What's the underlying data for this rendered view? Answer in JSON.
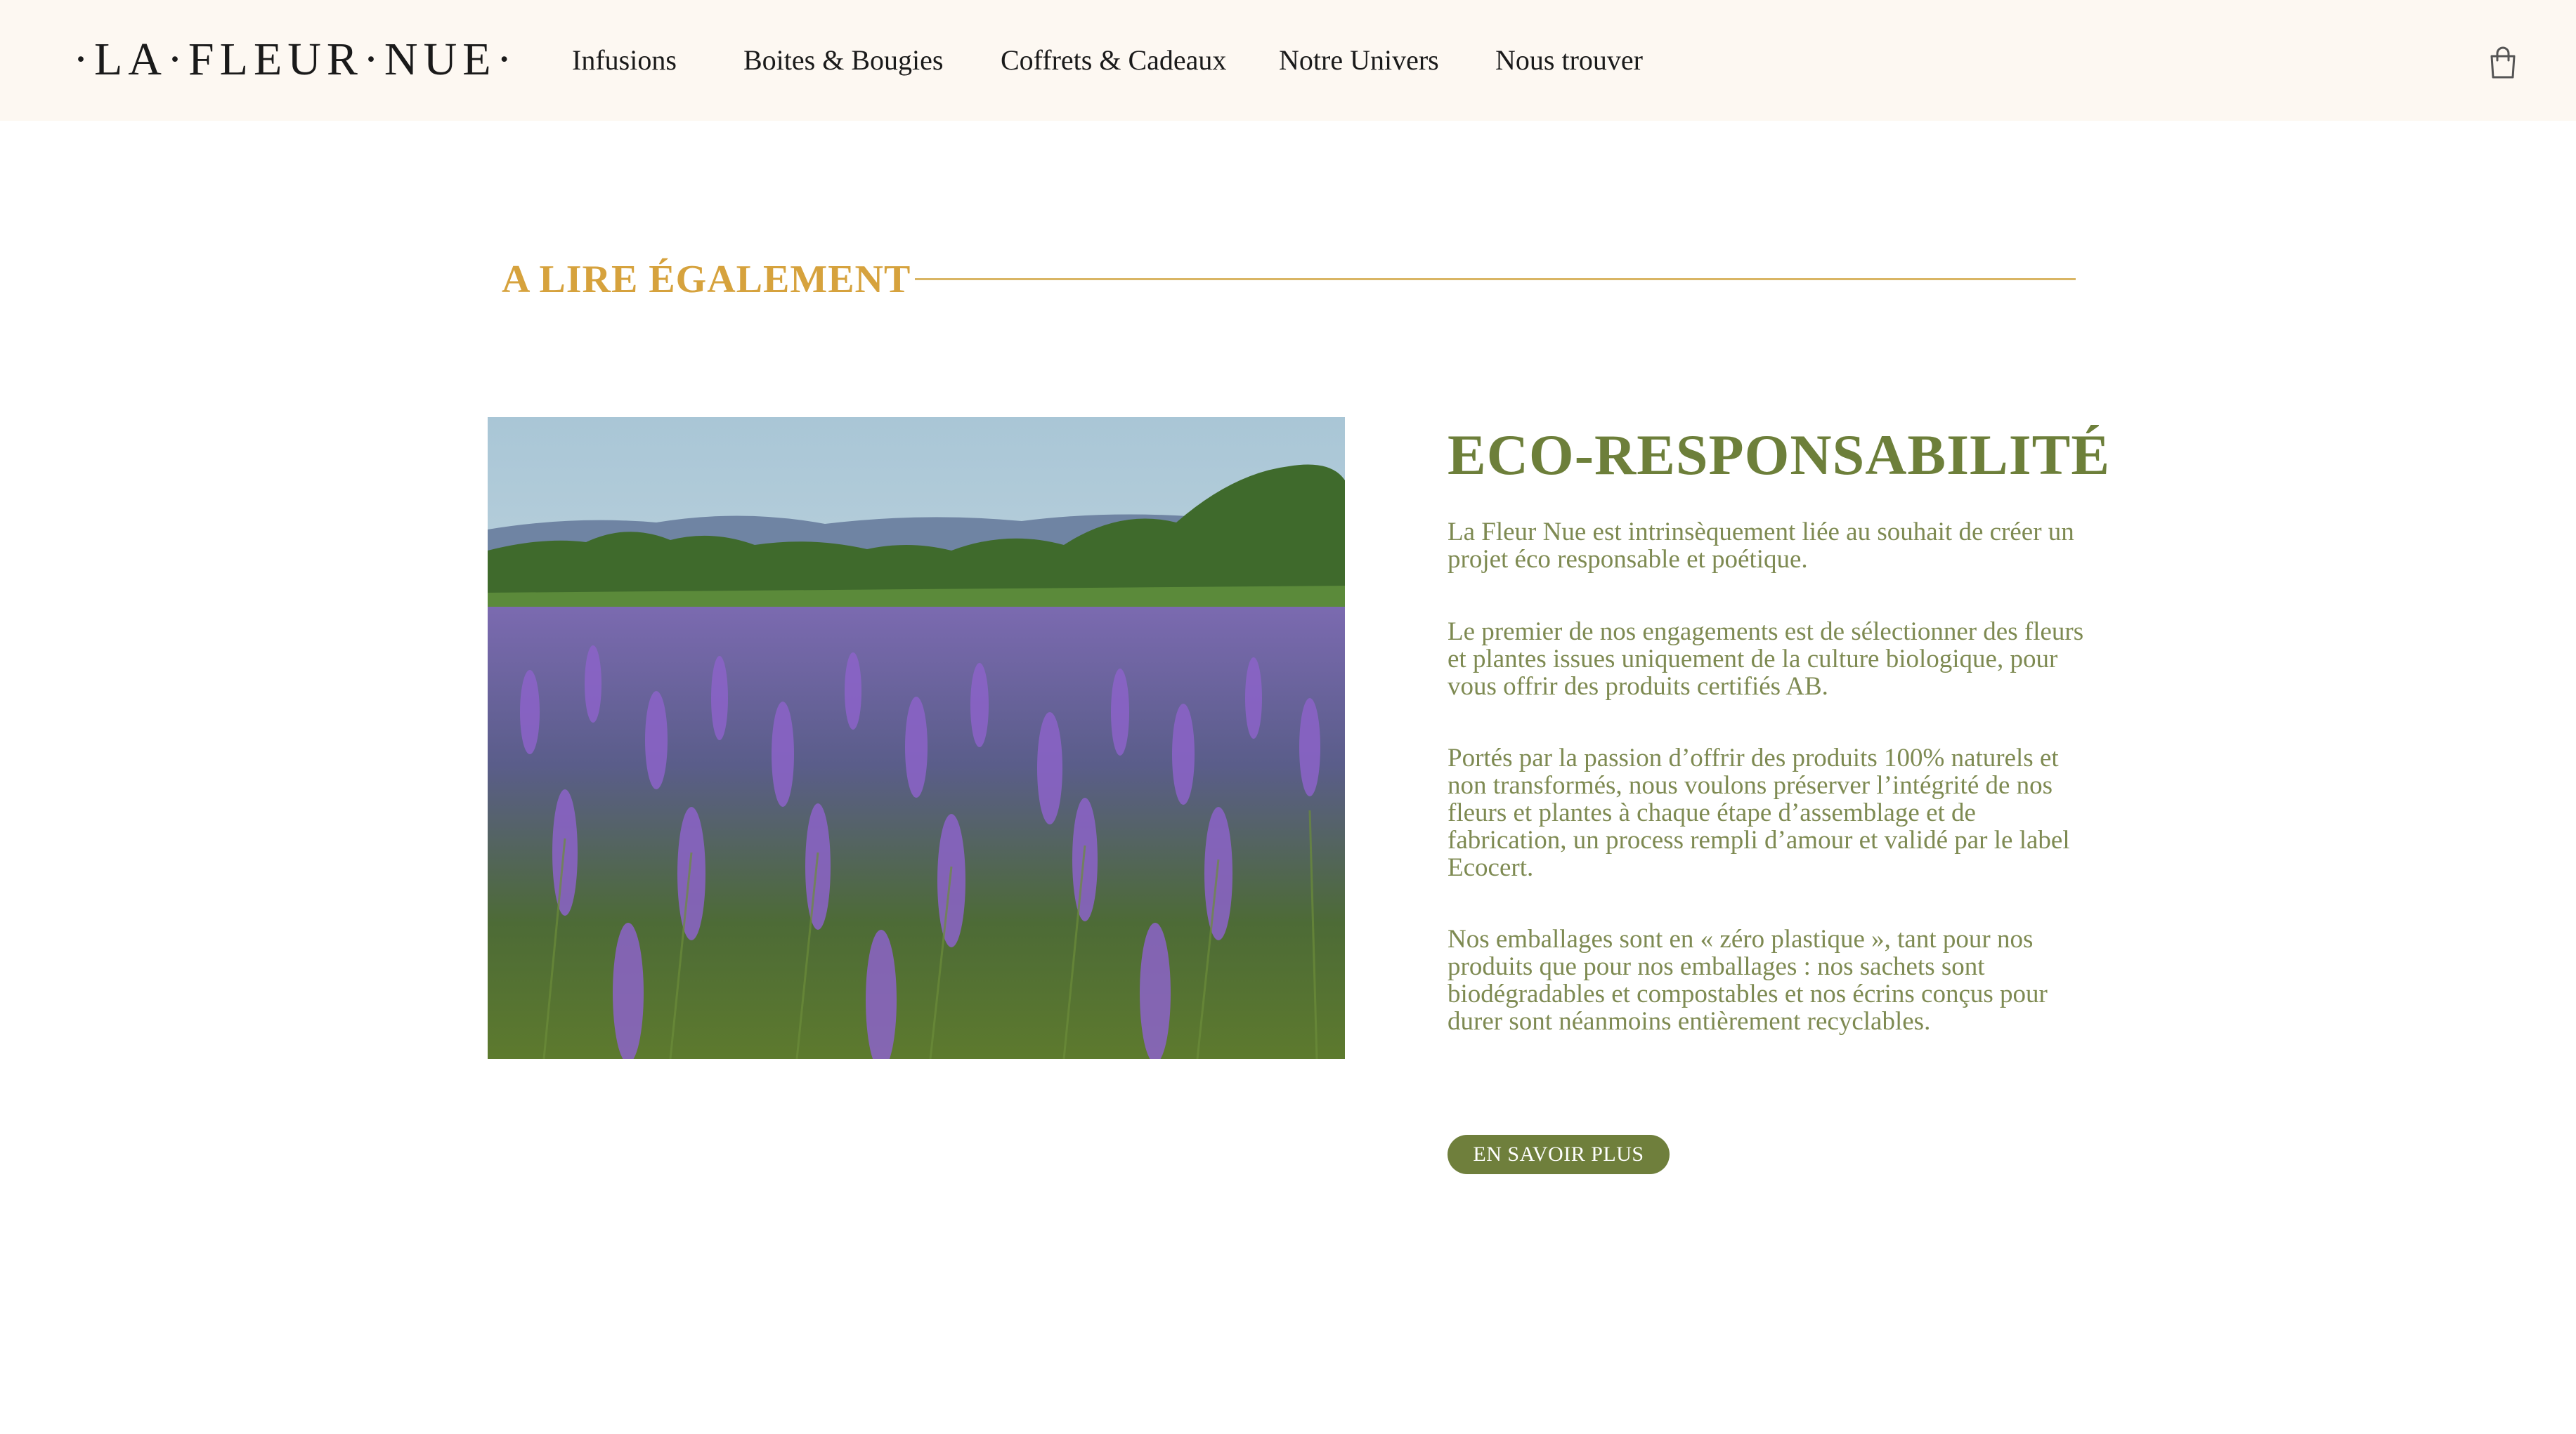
{
  "header": {
    "logo": "·LA·FLEUR·NUE·",
    "nav": [
      {
        "label": "Infusions"
      },
      {
        "label": "Boites & Bougies"
      },
      {
        "label": "Coffrets & Cadeaux"
      },
      {
        "label": "Notre Univers"
      },
      {
        "label": "Nous trouver"
      }
    ],
    "cart_icon": "shopping-bag-icon"
  },
  "section": {
    "title": "A LIRE ÉGALEMENT"
  },
  "article": {
    "title": "ECO-RESPONSABILITÉ",
    "paragraphs": [
      "La Fleur Nue est intrinsèquement liée au souhait de créer un projet éco responsable et poétique.",
      "Le premier de nos engagements est de sélectionner des fleurs et plantes issues uniquement de la culture biologique, pour vous offrir des produits certifiés AB.",
      "Portés par la passion d’offrir des produits 100% naturels et non transformés, nous voulons préserver l’intégrité de nos fleurs et plantes à chaque étape d’assemblage et de fabrication, un process rempli d’amour et validé par le label Ecocert.",
      "Nos emballages sont en « zéro plastique », tant pour nos produits que pour nos emballages : nos sachets sont biodégradables et compostables et nos écrins conçus pour durer sont néanmoins entièrement recyclables."
    ],
    "cta_label": "EN SAVOIR PLUS"
  },
  "colors": {
    "header_bg": "#fdf8f2",
    "accent_gold": "#d6a23d",
    "olive": "#6d7f3a",
    "text_olive": "#7e8a52"
  }
}
